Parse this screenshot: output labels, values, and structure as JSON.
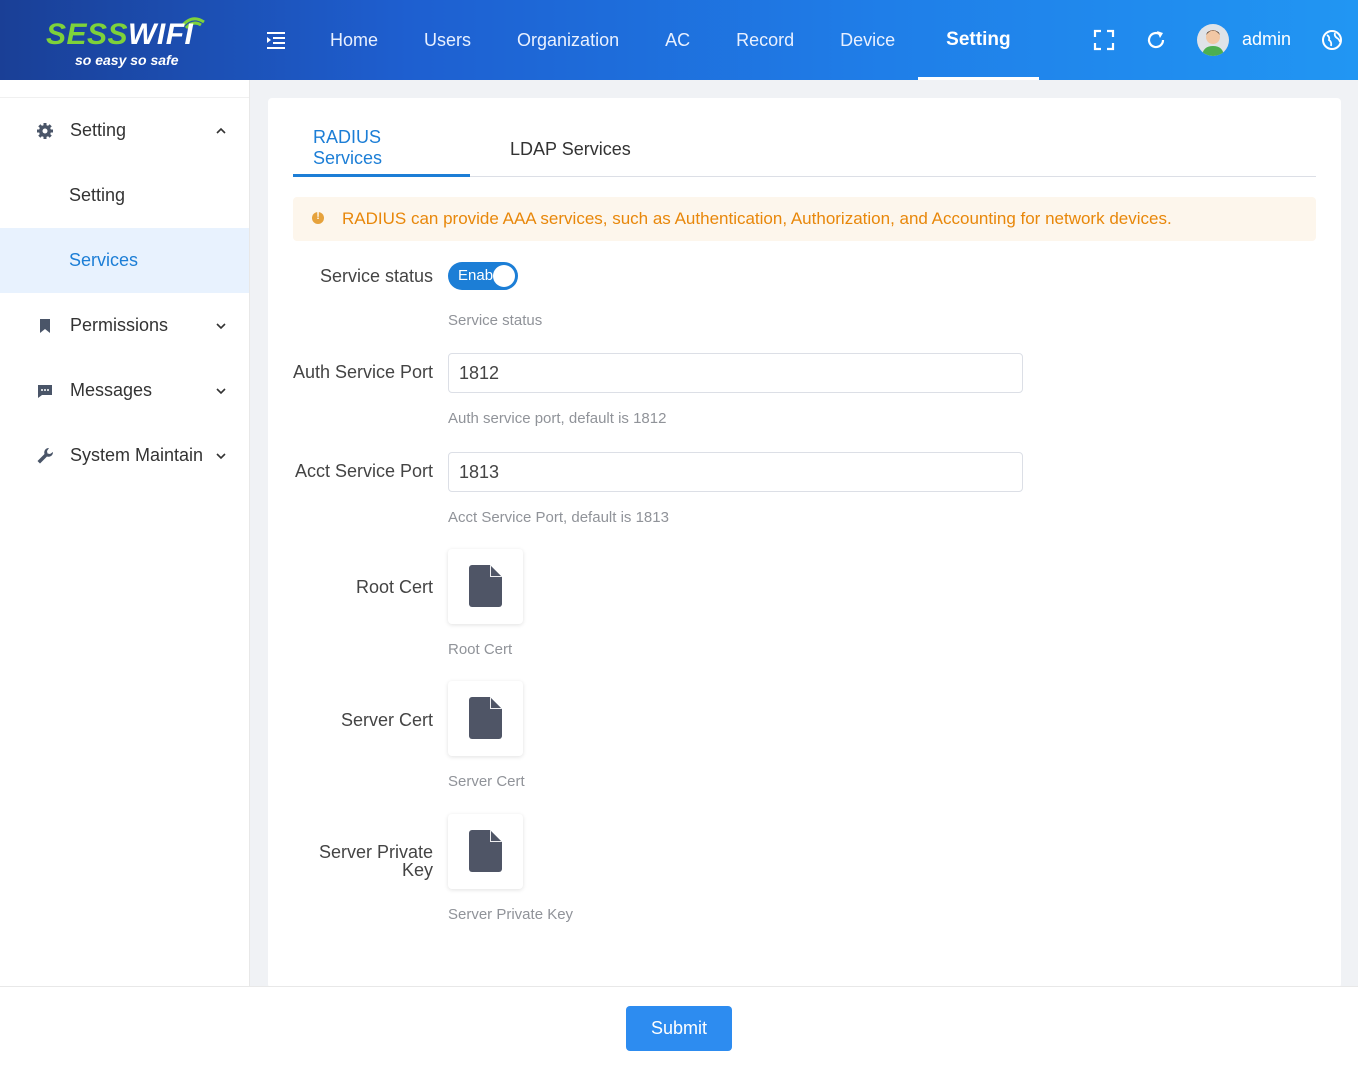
{
  "brand": {
    "logo_green": "SESS",
    "logo_white": "WIFI",
    "tagline": "so easy so safe",
    "accent_color": "#1c7ed6",
    "logo_green_color": "#7ed23a"
  },
  "header": {
    "nav": [
      "Home",
      "Users",
      "Organization",
      "AC",
      "Record",
      "Device",
      "Setting"
    ],
    "active_nav": "Setting",
    "user_name": "admin",
    "icons": [
      "menu-fold-icon",
      "fullscreen-icon",
      "refresh-icon",
      "avatar",
      "language-globe-icon"
    ]
  },
  "sidebar": {
    "groups": [
      {
        "label": "Setting",
        "icon": "gear-icon",
        "expanded": true
      },
      {
        "label": "Permissions",
        "icon": "bookmark-icon",
        "expanded": false
      },
      {
        "label": "Messages",
        "icon": "message-icon",
        "expanded": false
      },
      {
        "label": "System Maintain",
        "icon": "wrench-icon",
        "expanded": false
      }
    ],
    "sub_items": [
      "Setting",
      "Services"
    ],
    "active_sub": "Services"
  },
  "tabs": [
    "RADIUS Services",
    "LDAP Services"
  ],
  "active_tab": "RADIUS Services",
  "alert": {
    "text": "RADIUS can provide AAA services, such as Authentication, Authorization, and Accounting for network devices.",
    "color": "#e8870a"
  },
  "form": {
    "service_status": {
      "label": "Service status",
      "toggle_text": "Enab",
      "enabled": true,
      "hint": "Service status"
    },
    "auth_port": {
      "label": "Auth Service Port",
      "value": "1812",
      "hint": "Auth service port, default is 1812"
    },
    "acct_port": {
      "label": "Acct Service Port",
      "value": "1813",
      "hint": "Acct Service Port, default is 1813"
    },
    "root_cert": {
      "label": "Root Cert",
      "hint": "Root Cert",
      "icon": "file-icon"
    },
    "server_cert": {
      "label": "Server Cert",
      "hint": "Server Cert",
      "icon": "file-icon"
    },
    "server_private_key": {
      "label_line1": "Server Private",
      "label_line2": "Key",
      "hint": "Server Private Key",
      "icon": "file-icon"
    }
  },
  "submit_label": "Submit"
}
